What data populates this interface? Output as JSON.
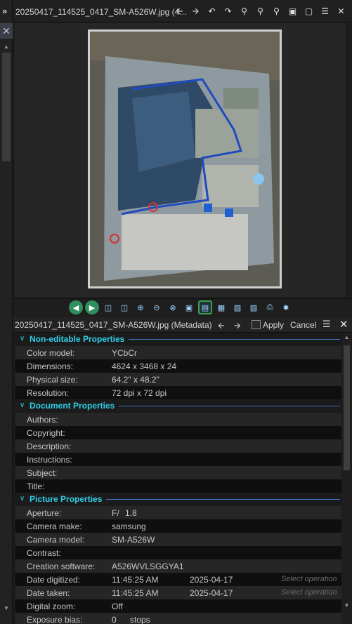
{
  "sidebar": {
    "expand_glyph": "»",
    "close_glyph": "✕"
  },
  "viewer": {
    "title": "20250417_114525_0417_SM-A526W.jpg (4...",
    "toolbar_icons": [
      "arrow-left-icon",
      "arrow-right-icon",
      "undo-icon",
      "redo-icon",
      "zoom-in-icon",
      "zoom-out-icon",
      "zoom-reset-icon",
      "fit-window-icon",
      "fullscreen-icon",
      "menu-icon",
      "close-icon"
    ],
    "nav_icons": [
      "previous-icon",
      "next-icon",
      "add-page-icon",
      "add-image-icon",
      "zoom-in-icon",
      "zoom-out-icon",
      "zoom-search-icon",
      "actual-size-icon",
      "fit-screen-icon",
      "calendar-icon",
      "slideshow-icon",
      "image-icon",
      "print-icon",
      "settings-icon"
    ]
  },
  "metadata": {
    "title": "20250417_114525_0417_SM-A526W.jpg (Metadata)",
    "apply_label": "Apply",
    "cancel_label": "Cancel",
    "sections": [
      {
        "label": "Non-editable Properties",
        "rows": [
          {
            "k": "Color model:",
            "v": "YCbCr"
          },
          {
            "k": "Dimensions:",
            "v": "4624 x 3468 x 24"
          },
          {
            "k": "Physical size:",
            "v": "64.2\" x 48.2\""
          },
          {
            "k": "Resolution:",
            "v": "72 dpi x 72 dpi"
          }
        ]
      },
      {
        "label": "Document Properties",
        "rows": [
          {
            "k": "Authors:",
            "v": ""
          },
          {
            "k": "Copyright:",
            "v": ""
          },
          {
            "k": "Description:",
            "v": ""
          },
          {
            "k": "Instructions:",
            "v": ""
          },
          {
            "k": "Subject:",
            "v": ""
          },
          {
            "k": "Title:",
            "v": ""
          }
        ]
      },
      {
        "label": "Picture Properties",
        "rows": [
          {
            "k": "Aperture:",
            "v": "F/",
            "u": "1.8"
          },
          {
            "k": "Camera make:",
            "v": "samsung"
          },
          {
            "k": "Camera model:",
            "v": "SM-A526W"
          },
          {
            "k": "Contrast:",
            "v": ""
          },
          {
            "k": "Creation software:",
            "v": "A526WVLSGGYA1"
          },
          {
            "k": "Date digitized:",
            "v": "11:45:25 AM",
            "v2": "2025-04-17",
            "v3": "Select operation"
          },
          {
            "k": "Date taken:",
            "v": "11:45:25 AM",
            "v2": "2025-04-17",
            "v3": "Select operation"
          },
          {
            "k": "Digital zoom:",
            "v": "Off"
          },
          {
            "k": "Exposure bias:",
            "v": "0",
            "u": "stops"
          }
        ]
      }
    ]
  },
  "colors": {
    "section_header": "#2ed0e8",
    "section_line": "#3f72b8",
    "active_border": "#38a34e"
  }
}
